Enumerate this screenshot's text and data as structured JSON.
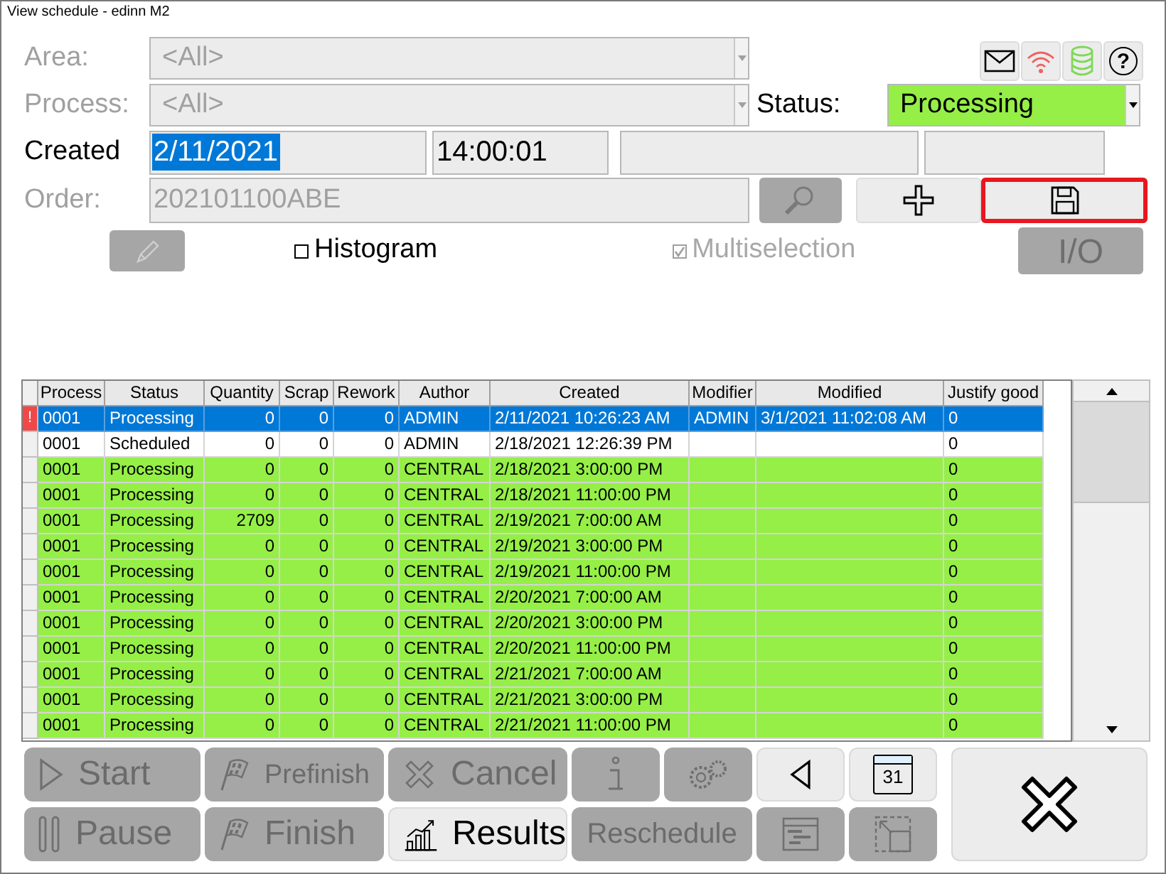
{
  "window": {
    "title": "View schedule - edinn M2"
  },
  "toolbar_icons": [
    {
      "kind": "mail"
    },
    {
      "kind": "wifi"
    },
    {
      "kind": "database"
    },
    {
      "kind": "help",
      "glyph": "?"
    }
  ],
  "filters": {
    "area": {
      "label": "Area:",
      "value": "<All>",
      "disabled": true
    },
    "process": {
      "label": "Process:",
      "value": "<All>",
      "disabled": true
    },
    "status": {
      "label": "Status:",
      "value": "Processing"
    },
    "created": {
      "label": "Created",
      "date": "2/11/2021",
      "time": "14:00:01"
    },
    "order": {
      "label": "Order:",
      "value": "202101100ABE",
      "disabled": true
    }
  },
  "actions": [
    {
      "kind": "search",
      "disabled": true,
      "highlighted": false
    },
    {
      "kind": "add",
      "disabled": false,
      "highlighted": false
    },
    {
      "kind": "save",
      "disabled": false,
      "highlighted": true
    }
  ],
  "options": {
    "edit_disabled": true,
    "histogram": {
      "label": "Histogram",
      "checked": false,
      "disabled": false
    },
    "multiselection": {
      "label": "Multiselection",
      "checked": true,
      "disabled": true
    },
    "io": {
      "label": "I/O",
      "disabled": true
    }
  },
  "table": {
    "columns": [
      "Process",
      "Status",
      "Quantity",
      "Scrap",
      "Rework",
      "Author",
      "Created",
      "Modifier",
      "Modified",
      "Justify good"
    ],
    "rows": [
      {
        "flag": "!",
        "selected": true,
        "color": "#0078d7",
        "cells": [
          "0001",
          "Processing",
          "0",
          "0",
          "0",
          "ADMIN",
          "2/11/2021 10:26:23 AM",
          "ADMIN",
          "3/1/2021 11:02:08 AM",
          "0"
        ]
      },
      {
        "selected": false,
        "color": "#ffffff",
        "cells": [
          "0001",
          "Scheduled",
          "0",
          "0",
          "0",
          "ADMIN",
          "2/18/2021 12:26:39 PM",
          "",
          "",
          "0"
        ]
      },
      {
        "selected": false,
        "color": "#95ef47",
        "cells": [
          "0001",
          "Processing",
          "0",
          "0",
          "0",
          "CENTRAL",
          "2/18/2021 3:00:00 PM",
          "",
          "",
          "0"
        ]
      },
      {
        "selected": false,
        "color": "#95ef47",
        "cells": [
          "0001",
          "Processing",
          "0",
          "0",
          "0",
          "CENTRAL",
          "2/18/2021 11:00:00 PM",
          "",
          "",
          "0"
        ]
      },
      {
        "selected": false,
        "color": "#95ef47",
        "cells": [
          "0001",
          "Processing",
          "2709",
          "0",
          "0",
          "CENTRAL",
          "2/19/2021 7:00:00 AM",
          "",
          "",
          "0"
        ]
      },
      {
        "selected": false,
        "color": "#95ef47",
        "cells": [
          "0001",
          "Processing",
          "0",
          "0",
          "0",
          "CENTRAL",
          "2/19/2021 3:00:00 PM",
          "",
          "",
          "0"
        ]
      },
      {
        "selected": false,
        "color": "#95ef47",
        "cells": [
          "0001",
          "Processing",
          "0",
          "0",
          "0",
          "CENTRAL",
          "2/19/2021 11:00:00 PM",
          "",
          "",
          "0"
        ]
      },
      {
        "selected": false,
        "color": "#95ef47",
        "cells": [
          "0001",
          "Processing",
          "0",
          "0",
          "0",
          "CENTRAL",
          "2/20/2021 7:00:00 AM",
          "",
          "",
          "0"
        ]
      },
      {
        "selected": false,
        "color": "#95ef47",
        "cells": [
          "0001",
          "Processing",
          "0",
          "0",
          "0",
          "CENTRAL",
          "2/20/2021 3:00:00 PM",
          "",
          "",
          "0"
        ]
      },
      {
        "selected": false,
        "color": "#95ef47",
        "cells": [
          "0001",
          "Processing",
          "0",
          "0",
          "0",
          "CENTRAL",
          "2/20/2021 11:00:00 PM",
          "",
          "",
          "0"
        ]
      },
      {
        "selected": false,
        "color": "#95ef47",
        "cells": [
          "0001",
          "Processing",
          "0",
          "0",
          "0",
          "CENTRAL",
          "2/21/2021 7:00:00 AM",
          "",
          "",
          "0"
        ]
      },
      {
        "selected": false,
        "color": "#95ef47",
        "cells": [
          "0001",
          "Processing",
          "0",
          "0",
          "0",
          "CENTRAL",
          "2/21/2021 3:00:00 PM",
          "",
          "",
          "0"
        ]
      },
      {
        "selected": false,
        "color": "#95ef47",
        "cells": [
          "0001",
          "Processing",
          "0",
          "0",
          "0",
          "CENTRAL",
          "2/21/2021 11:00:00 PM",
          "",
          "",
          "0"
        ]
      }
    ]
  },
  "buttons": [
    {
      "kind": "start",
      "label": "Start",
      "disabled": true
    },
    {
      "kind": "prefinish",
      "label": "Prefinish",
      "disabled": true
    },
    {
      "kind": "cancel",
      "label": "Cancel",
      "disabled": true
    },
    {
      "kind": "info",
      "disabled": true
    },
    {
      "kind": "gear",
      "disabled": true
    },
    {
      "kind": "back",
      "disabled": false
    },
    {
      "kind": "calendar",
      "label": "31",
      "disabled": false
    },
    {
      "kind": "pause",
      "label": "Pause",
      "disabled": true
    },
    {
      "kind": "finish",
      "label": "Finish",
      "disabled": true
    },
    {
      "kind": "results",
      "label": "Results",
      "disabled": false
    },
    {
      "kind": "reschedule",
      "label": "Reschedule",
      "disabled": true
    },
    {
      "kind": "planner",
      "disabled": true
    },
    {
      "kind": "resize",
      "disabled": true
    }
  ],
  "close_button": {
    "disabled": false
  }
}
